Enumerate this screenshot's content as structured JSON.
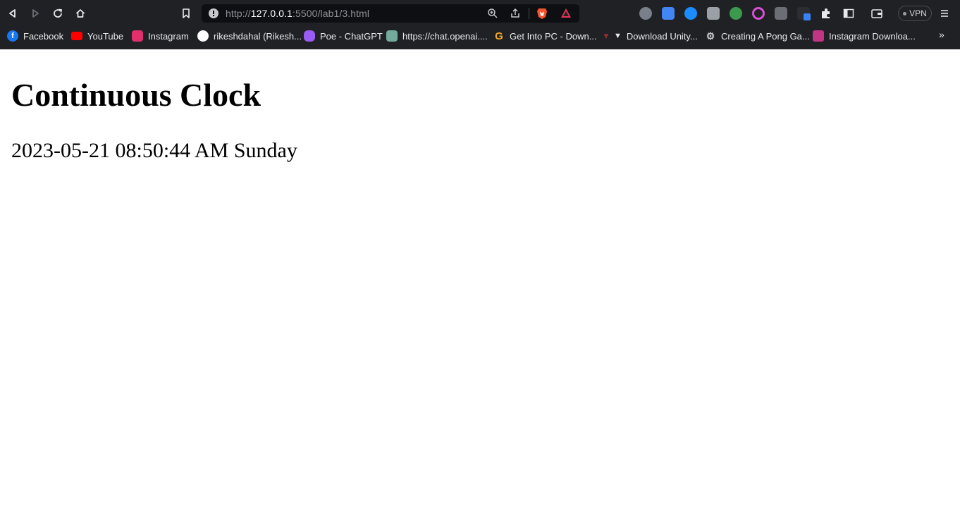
{
  "browser": {
    "url": {
      "scheme": "http://",
      "host": "127.0.0.1",
      "rest": ":5500/lab1/3.html"
    },
    "vpn_label": "VPN",
    "bookmarks": [
      {
        "label": "Facebook",
        "icon": "facebook-icon",
        "color": "#1877f2"
      },
      {
        "label": "YouTube",
        "icon": "youtube-icon",
        "color": "#ff0000"
      },
      {
        "label": "Instagram",
        "icon": "instagram-icon",
        "color": "#e1306c"
      },
      {
        "label": "rikeshdahal (Rikesh...",
        "icon": "github-icon",
        "color": "#ffffff"
      },
      {
        "label": "Poe - ChatGPT",
        "icon": "poe-icon",
        "color": "#9b5cf6"
      },
      {
        "label": "https://chat.openai....",
        "icon": "openai-icon",
        "color": "#74aa9c"
      },
      {
        "label": "Get Into PC - Down...",
        "icon": "getintopc-icon",
        "color": "#f5a623"
      },
      {
        "label": "Download Unity...",
        "icon": "unity-icon",
        "color": "#8b2f2f"
      },
      {
        "label": "Creating A Pong Ga...",
        "icon": "gears-icon",
        "color": "#c9cbd0"
      },
      {
        "label": "Instagram Downloa...",
        "icon": "instagram-downloader-icon",
        "color": "#c13584"
      }
    ]
  },
  "page": {
    "title": "Continuous Clock",
    "clock_text": "2023-05-21 08:50:44 AM Sunday"
  }
}
